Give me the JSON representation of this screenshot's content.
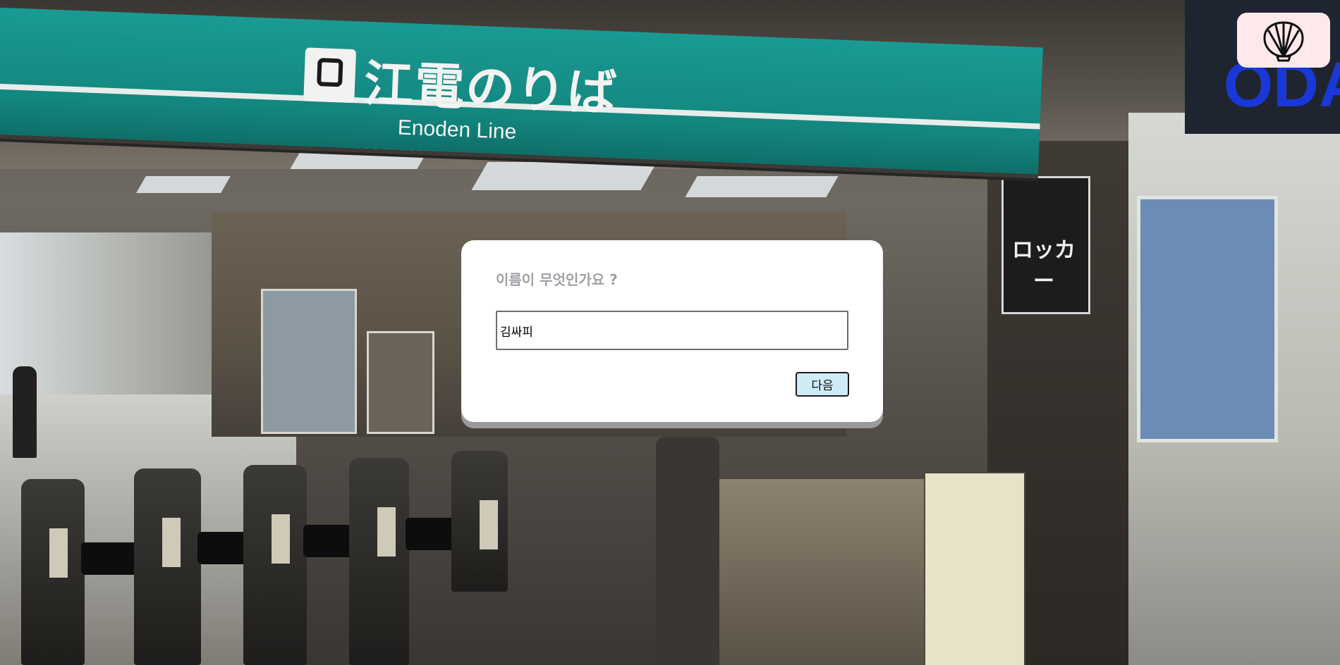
{
  "background": {
    "sign_japanese": "江電のりば",
    "sign_english": "Enoden Line",
    "locker_sign": "ロッカー",
    "blue_letters": "ODA"
  },
  "dialog": {
    "question": "이름이 무엇인가요 ?",
    "name_value": "김싸피",
    "next_label": "다음"
  },
  "corner": {
    "icon": "shell-icon",
    "button_color": "#fde9ec"
  },
  "colors": {
    "dialog_bg": "#ffffff",
    "question_text": "#9ea1a6",
    "button_bg": "#cfecf6"
  }
}
